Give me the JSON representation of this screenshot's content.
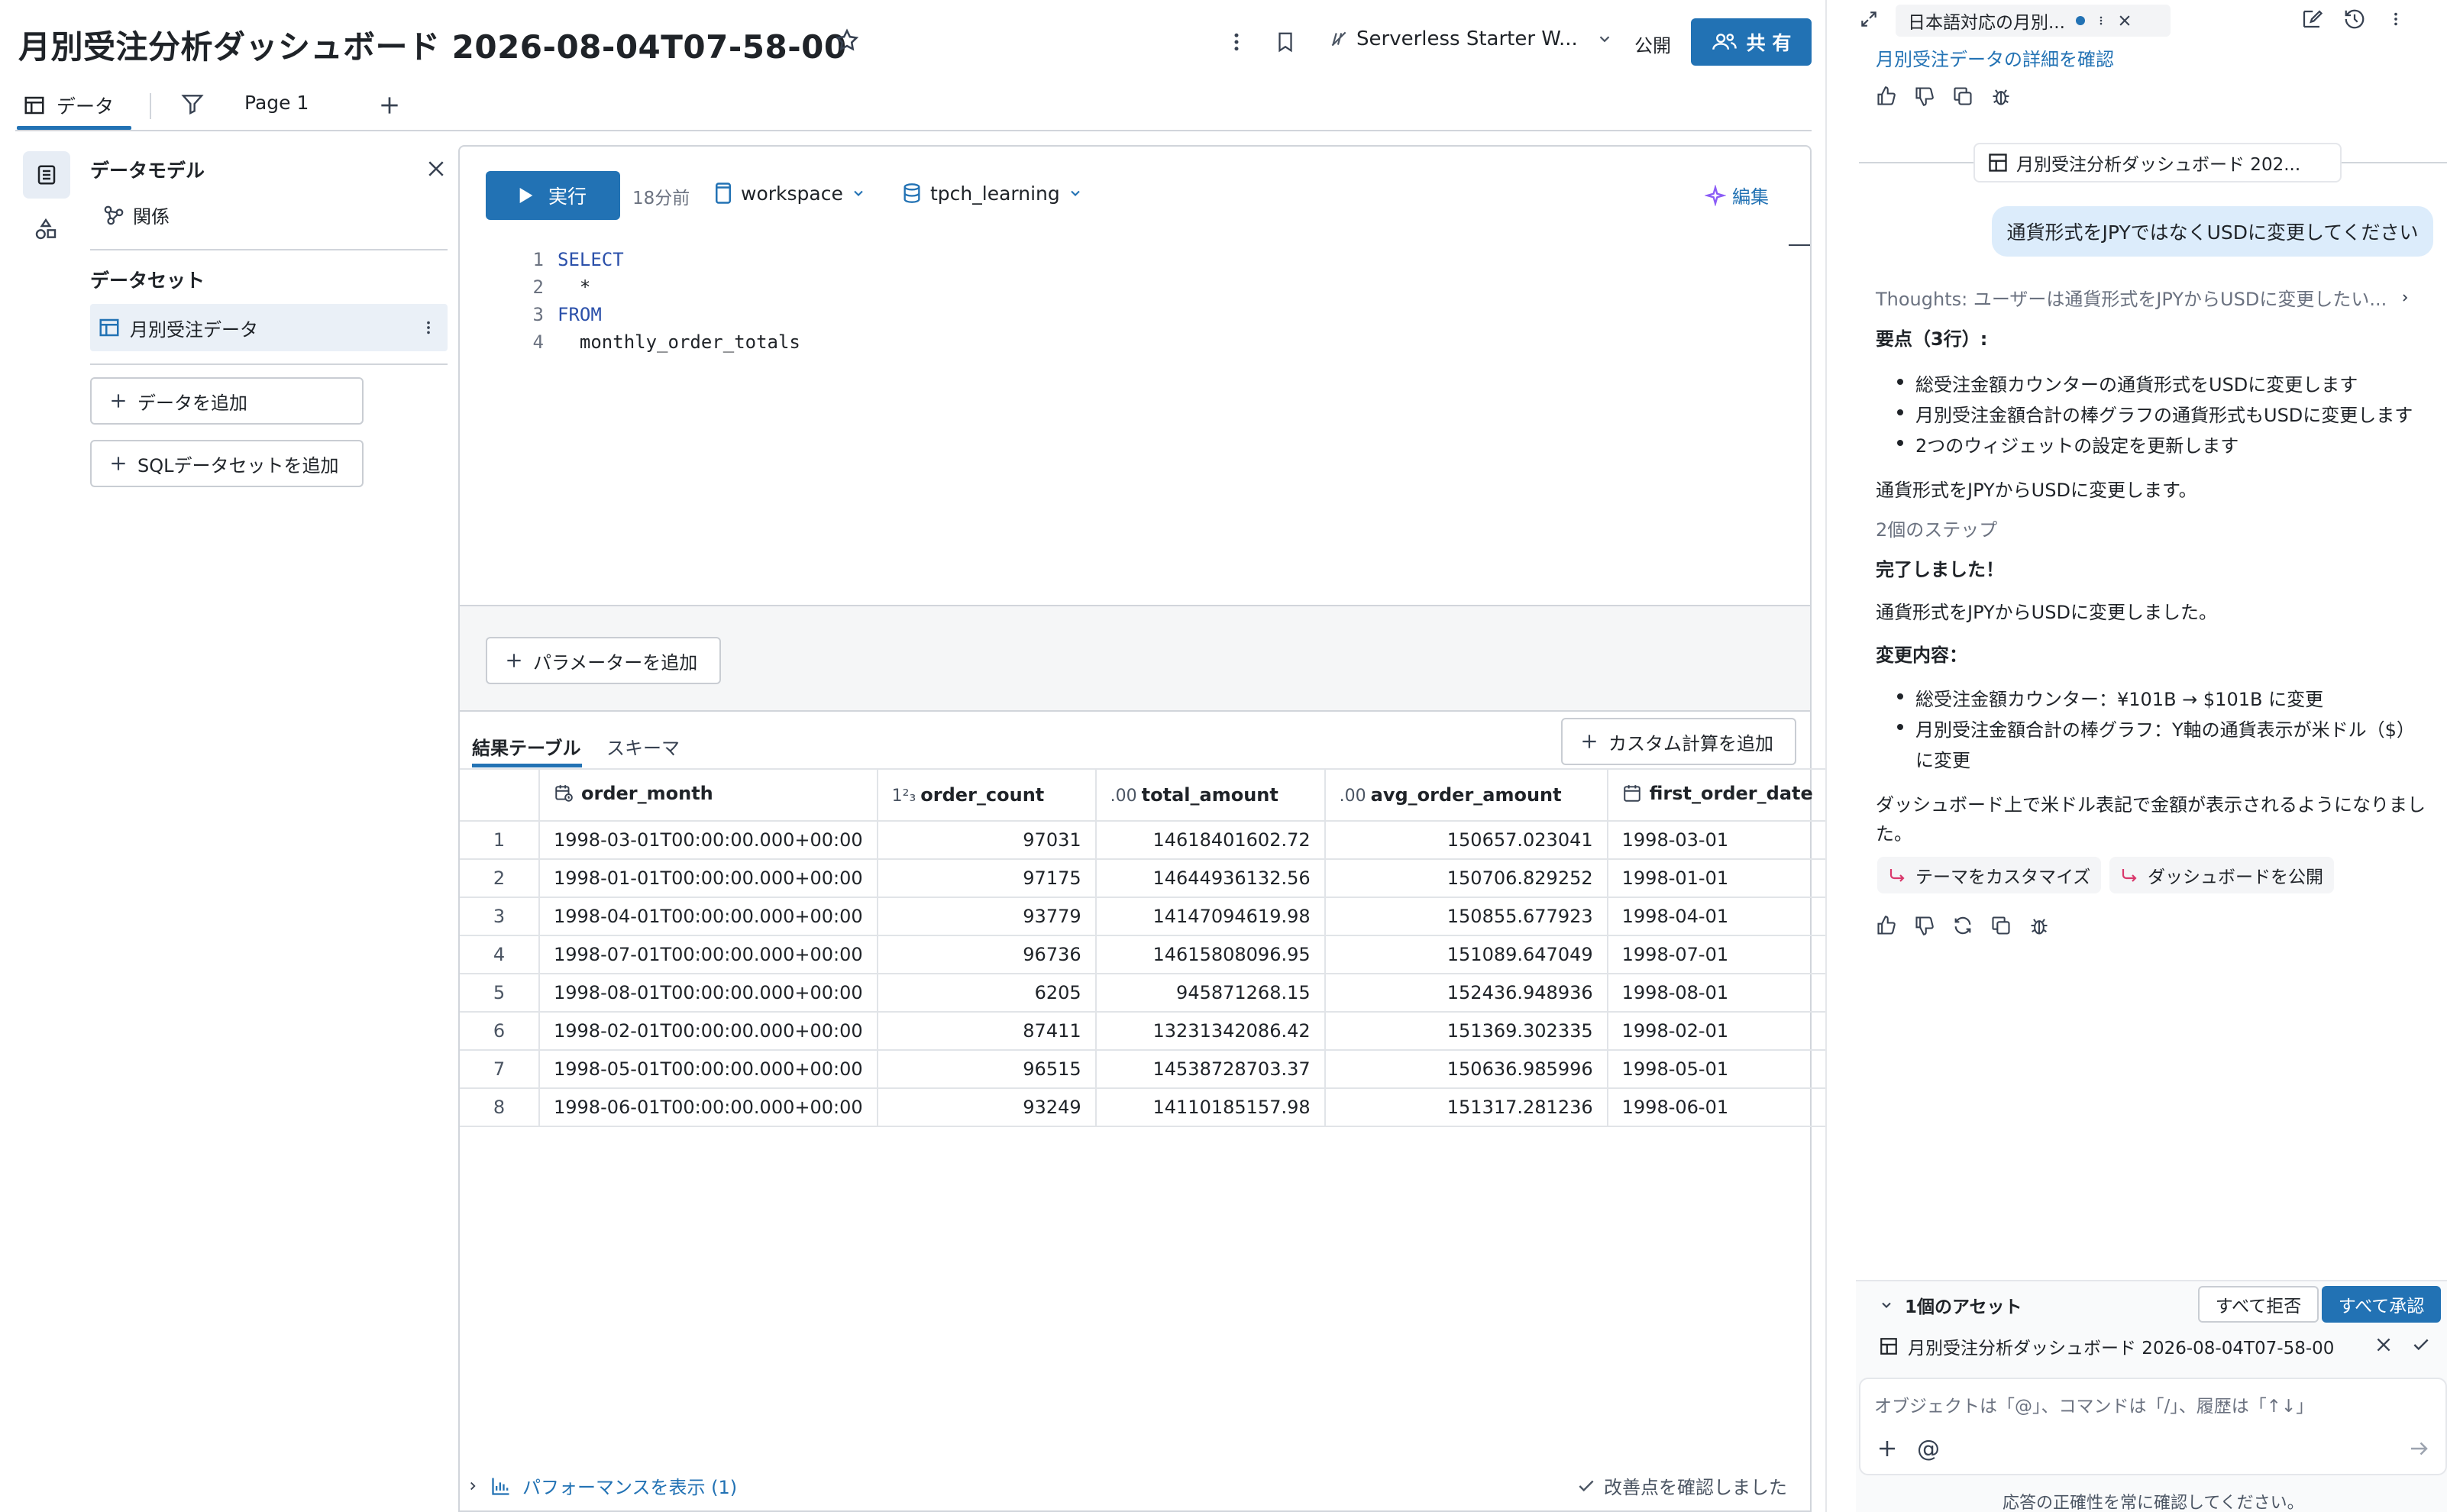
{
  "header": {
    "title": "月別受注分析ダッシュボード 2026-08-04T07-58-00",
    "warehouse": "Serverless Starter W...",
    "publish_label": "公開",
    "share_label": "共 有"
  },
  "tabs": [
    {
      "label": "データ"
    },
    {
      "label": "Page 1"
    }
  ],
  "data_model": {
    "title": "データモデル",
    "relations_label": "関係",
    "datasets_title": "データセット",
    "dataset_name": "月別受注データ",
    "add_data_label": "データを追加",
    "add_sql_dataset_label": "SQLデータセットを追加"
  },
  "editor": {
    "run_label": "実行",
    "last_run": "18分前",
    "catalog": "workspace",
    "schema": "tpch_learning",
    "edit_label": "編集",
    "code_lines": [
      {
        "num": "1",
        "text": "SELECT",
        "kw": true
      },
      {
        "num": "2",
        "text": "  *",
        "kw": false
      },
      {
        "num": "3",
        "text": "FROM",
        "kw": true
      },
      {
        "num": "4",
        "text": "  monthly_order_totals",
        "kw": false
      }
    ],
    "add_parameter_label": "パラメーターを追加"
  },
  "results": {
    "tab_table": "結果テーブル",
    "tab_schema": "スキーマ",
    "add_custom_calc_label": "カスタム計算を追加",
    "columns": [
      {
        "name": "order_month",
        "type_icon": "calendar-clock-icon"
      },
      {
        "name": "order_count",
        "type_label": "1²₃"
      },
      {
        "name": "total_amount",
        "type_label": ".00"
      },
      {
        "name": "avg_order_amount",
        "type_label": ".00"
      },
      {
        "name": "first_order_date",
        "type_icon": "calendar-icon"
      }
    ],
    "rows": [
      [
        "1",
        "1998-03-01T00:00:00.000+00:00",
        "97031",
        "14618401602.72",
        "150657.023041",
        "1998-03-01"
      ],
      [
        "2",
        "1998-01-01T00:00:00.000+00:00",
        "97175",
        "14644936132.56",
        "150706.829252",
        "1998-01-01"
      ],
      [
        "3",
        "1998-04-01T00:00:00.000+00:00",
        "93779",
        "14147094619.98",
        "150855.677923",
        "1998-04-01"
      ],
      [
        "4",
        "1998-07-01T00:00:00.000+00:00",
        "96736",
        "14615808096.95",
        "151089.647049",
        "1998-07-01"
      ],
      [
        "5",
        "1998-08-01T00:00:00.000+00:00",
        "6205",
        "945871268.15",
        "152436.948936",
        "1998-08-01"
      ],
      [
        "6",
        "1998-02-01T00:00:00.000+00:00",
        "87411",
        "13231342086.42",
        "151369.302335",
        "1998-02-01"
      ],
      [
        "7",
        "1998-05-01T00:00:00.000+00:00",
        "96515",
        "14538728703.37",
        "150636.985996",
        "1998-05-01"
      ],
      [
        "8",
        "1998-06-01T00:00:00.000+00:00",
        "93249",
        "14110185157.98",
        "151317.281236",
        "1998-06-01"
      ]
    ],
    "performance_label": "パフォーマンスを表示 (1)",
    "improvement_label": "改善点を確認しました"
  },
  "assistant": {
    "tab_title": "日本語対応の月別...",
    "prev_link": "月別受注データの詳細を確認",
    "dashboard_chip": "月別受注分析ダッシュボード 202...",
    "user_message": "通貨形式をJPYではなくUSDに変更してください",
    "thoughts": "Thoughts: ユーザーは通貨形式をJPYからUSDに変更したい...",
    "summary_title": "要点（3行）:",
    "summary_items": [
      "総受注金額カウンターの通貨形式をUSDに変更します",
      "月別受注金額合計の棒グラフの通貨形式もUSDに変更します",
      "2つのウィジェットの設定を更新します"
    ],
    "plan_text": "通貨形式をJPYからUSDに変更します。",
    "steps_label": "2個のステップ",
    "done_title": "完了しました！",
    "done_text": "通貨形式をJPYからUSDに変更しました。",
    "changes_title": "変更内容：",
    "change_items": [
      "総受注金額カウンター：¥101B → $101B に変更",
      "月別受注金額合計の棒グラフ：Y軸の通貨表示が米ドル（$）",
      "に変更"
    ],
    "closing_text_1": "ダッシュボード上で米ドル表記で金額が表示されるようになりまし",
    "closing_text_2": "た。",
    "action_theme": "テーマをカスタマイズ",
    "action_publish": "ダッシュボードを公開",
    "assets_label": "1個のアセット",
    "reject_all": "すべて拒否",
    "accept_all": "すべて承認",
    "asset_name": "月別受注分析ダッシュボード 2026-08-04T07-58-00",
    "input_placeholder": "オブジェクトは「@」、コマンドは「/」、履歴は「↑↓」",
    "disclaimer": "応答の正確性を常に確認してください。"
  },
  "colors": {
    "accent": "#2272b4",
    "accent_light": "#dcecfb"
  }
}
